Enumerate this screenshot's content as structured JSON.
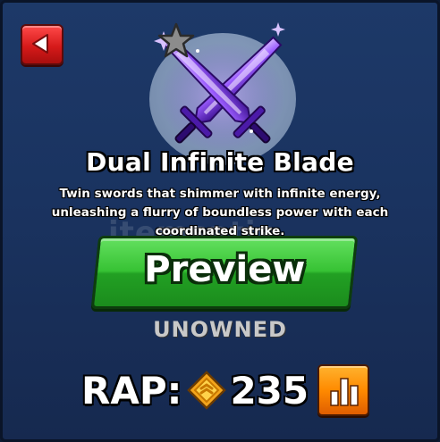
{
  "item": {
    "name": "Dual Infinite Blade",
    "description": "Twin swords that shimmer with infinite energy, unleashing a flurry of boundless power with each coordinated strike.",
    "status": "UNOWNED"
  },
  "buttons": {
    "preview_label": "Preview"
  },
  "rap": {
    "label": "RAP:",
    "value": "235"
  },
  "watermark": "itemsatis",
  "icons": {
    "back": "back-arrow-icon",
    "rarity": "star-icon",
    "currency": "coin-icon",
    "stats": "bar-chart-icon"
  },
  "colors": {
    "panel_bg": "#1a3360",
    "back_button": "#d61a1a",
    "preview_button": "#37c234",
    "stats_button": "#ff8a00",
    "status_text": "#c8c8c8",
    "blade_glow": "#9b5cff"
  }
}
